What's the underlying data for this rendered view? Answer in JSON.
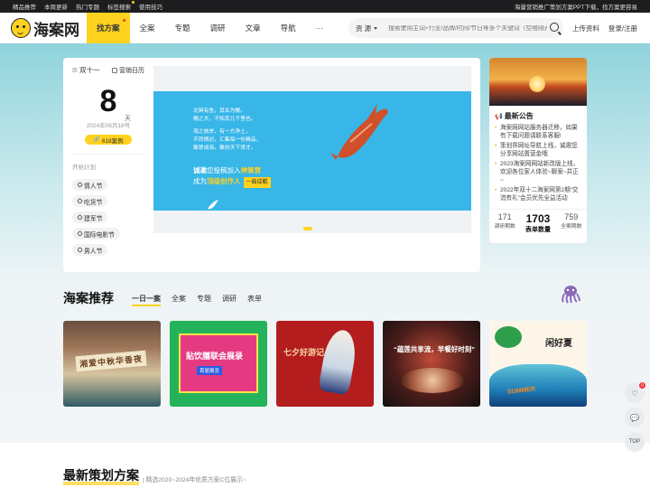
{
  "topbar": {
    "links": [
      "精品推荐",
      "本周更新",
      "热门专题",
      "标签搜索",
      "使用技巧"
    ],
    "promo": "海量营销推广策划方案PPT下载，找方案更容易"
  },
  "nav": {
    "logo_text": "海案网",
    "menu": [
      "找方案",
      "全案",
      "专题",
      "调研",
      "文章",
      "导航",
      "···"
    ],
    "search_type": "资 源",
    "search_placeholder": "搜索使用主词+行业/品牌/时间/节日等多个关键词（空格隔开）",
    "upload": "上传资料",
    "login": "登录/注册"
  },
  "calendar": {
    "event": "双十一",
    "calendar_link": "营销日历",
    "days_left": "8",
    "unit": "天",
    "date": "2024年06月18号",
    "cases": "618案例",
    "plan_title": "开始计划",
    "tags": [
      "情人节",
      "吃货节",
      "建军节",
      "国际电影节",
      "男人节"
    ]
  },
  "banner": {
    "poem": [
      "北冥有鱼，其名为鲲。",
      "鲲之大，不知其几千里也。",
      "",
      "海之彼岸，有一方净土，",
      "不拜栖迟，汇集每一份精品，",
      "聚慧成海，聚创天下贤才。"
    ],
    "cta_line1_pre": "诚邀",
    "cta_line1_mid": "您投稿加入",
    "cta_line1_hl": "神策营",
    "cta_line2_pre": "成为",
    "cta_line2_hl": "顶级创作人",
    "cta_button": "一鼓成鲲"
  },
  "notice": {
    "title": "最新公告",
    "items": [
      "海案网网站服务器迁移，如果有下载问题请联系客服!",
      "策划界网址导航上线，诚邀您分享网站置营金哦",
      "2023海案网网站新改版上线，欢迎各位家人体验~聊案~并正~",
      "2022年双十二海案网第2期“交流有礼”会员优先全益活动"
    ],
    "stats": [
      {
        "num": "171",
        "label": "调研期数"
      },
      {
        "num": "1703",
        "label": "表单数量"
      },
      {
        "num": "759",
        "label": "全案期数"
      }
    ]
  },
  "section1": {
    "title": "海案推荐",
    "tabs": [
      "一日一案",
      "全案",
      "专题",
      "调研",
      "表单"
    ],
    "thumbs": [
      {
        "title": "湘爱中秋华香夜"
      },
      {
        "title": "贴饮膳联会展录",
        "chip": "首届展览"
      },
      {
        "title": "七夕好游记"
      },
      {
        "title": "“蕴莲共享流，早餐好时刻”"
      },
      {
        "title": "闲好夏",
        "sub": "SUMMER"
      }
    ]
  },
  "section2": {
    "title": "最新策划方案",
    "sub": "| 精选2020~2024年优质方案C位展示~"
  },
  "float": {
    "badge": "0",
    "top": "TOP"
  },
  "colors": {
    "accent": "#ffd21f",
    "banner": "#38b6e8"
  }
}
